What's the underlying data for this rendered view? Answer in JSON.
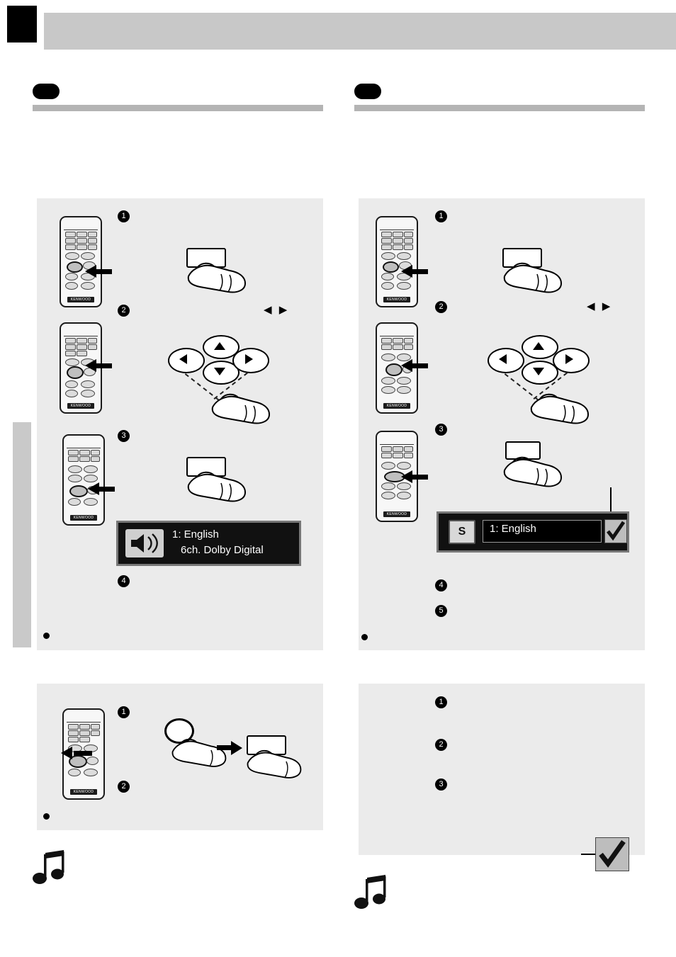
{
  "document": {
    "page_kind": "instruction-manual-page",
    "columns": [
      {
        "id": "left",
        "sections": [
          {
            "id": "left-top",
            "title": "",
            "steps": [
              "1",
              "2",
              "3",
              "4"
            ],
            "bullet": "",
            "osd": {
              "icon": "speaker-icon",
              "line1": "1: English",
              "line2": "6ch. Dolby Digital"
            }
          },
          {
            "id": "left-bottom",
            "title": "",
            "steps": [
              "1",
              "2"
            ],
            "bullet": ""
          }
        ]
      },
      {
        "id": "right",
        "sections": [
          {
            "id": "right-top",
            "title": "",
            "steps": [
              "1",
              "2",
              "3",
              "4",
              "5"
            ],
            "bullet": "",
            "osd": {
              "badge": "S",
              "field": "1: English",
              "check": "checkmark-icon"
            }
          },
          {
            "id": "right-bottom",
            "title": "",
            "steps": [
              "1",
              "2",
              "3"
            ],
            "check": "checkmark-icon"
          }
        ]
      }
    ],
    "remote": {
      "brand": "KENWOOD"
    },
    "glyphs": {
      "left_right_arrows": "◀ ▶",
      "music_note": "music-note-icon"
    }
  }
}
